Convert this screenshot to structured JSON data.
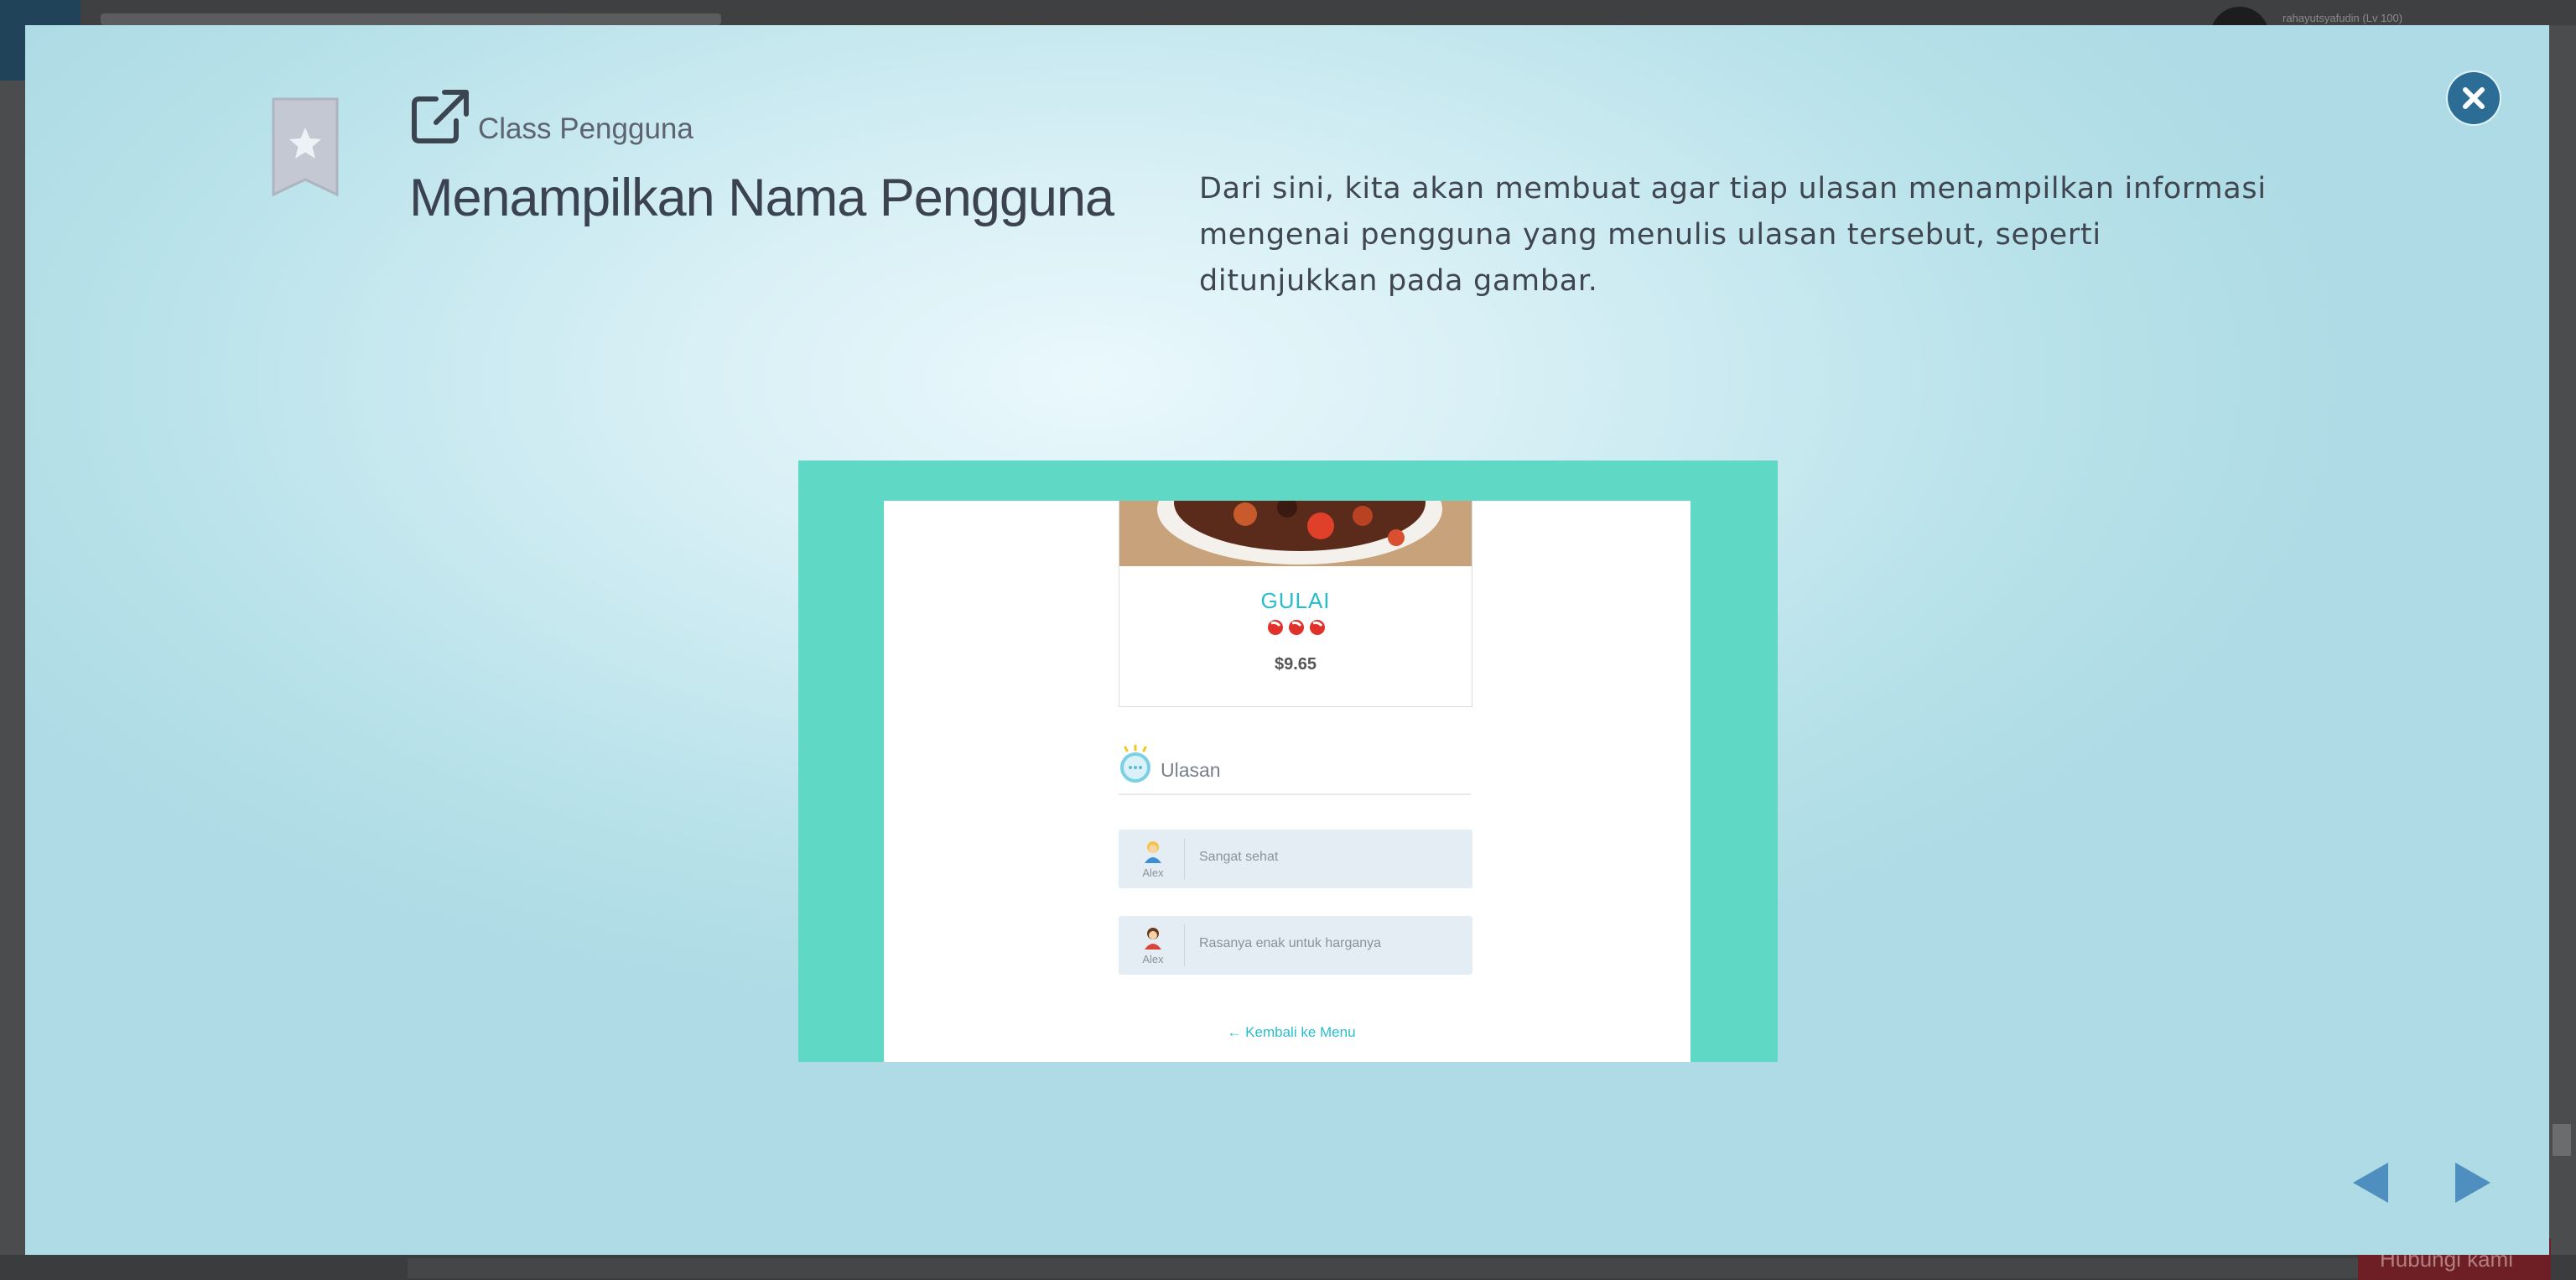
{
  "background": {
    "username": "rahayutsyafudin (Lv 100)",
    "bottom_button": "Hubungi kami"
  },
  "modal": {
    "section_label": "Class Pengguna",
    "title": "Menampilkan Nama Pengguna",
    "description": "Dari sini, kita akan membuat agar tiap ulasan menampilkan informasi mengenai pengguna yang menulis ulasan tersebut, seperti ditunjukkan pada gambar."
  },
  "illustration": {
    "food_name": "GULAI",
    "price": "$9.65",
    "reviews_title": "Ulasan",
    "reviews": [
      {
        "author": "Alex",
        "text": "Sangat sehat"
      },
      {
        "author": "Alex",
        "text": "Rasanya enak untuk harganya"
      }
    ],
    "back_link": "← Kembali ke Menu"
  },
  "icons": {
    "bookmark": "bookmark-star-icon",
    "external": "external-link-icon",
    "close": "close-icon",
    "prev": "arrow-left-icon",
    "next": "arrow-right-icon"
  },
  "colors": {
    "accent": "#2c6d96",
    "nav_arrow": "#4f8fbf",
    "illustration_bg": "#5fd9c5",
    "food_name": "#27bcd0"
  }
}
